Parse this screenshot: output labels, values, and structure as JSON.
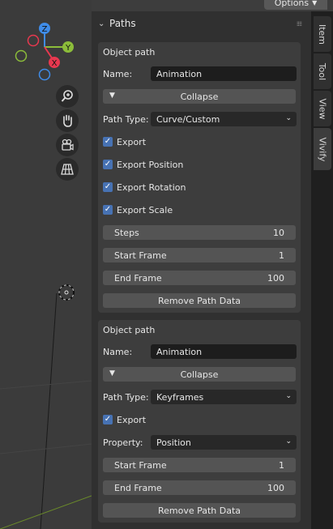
{
  "header": {
    "options_label": "Options"
  },
  "gizmo": {
    "z": "Z",
    "y": "Y",
    "x": "X"
  },
  "panel": {
    "title": "Paths",
    "paths": [
      {
        "heading": "Object path",
        "name_label": "Name:",
        "name_value": "Animation",
        "collapse_label": "Collapse",
        "path_type_label": "Path Type:",
        "path_type_value": "Curve/Custom",
        "checkboxes": [
          "Export",
          "Export Position",
          "Export Rotation",
          "Export Scale"
        ],
        "fields": [
          {
            "label": "Steps",
            "value": "10"
          },
          {
            "label": "Start Frame",
            "value": "1"
          },
          {
            "label": "End Frame",
            "value": "100"
          }
        ],
        "remove_label": "Remove Path Data"
      },
      {
        "heading": "Object path",
        "name_label": "Name:",
        "name_value": "Animation",
        "collapse_label": "Collapse",
        "path_type_label": "Path Type:",
        "path_type_value": "Keyframes",
        "checkboxes": [
          "Export"
        ],
        "property_label": "Property:",
        "property_value": "Position",
        "fields": [
          {
            "label": "Start Frame",
            "value": "1"
          },
          {
            "label": "End Frame",
            "value": "100"
          }
        ],
        "remove_label": "Remove Path Data"
      }
    ]
  },
  "tabs": [
    "Item",
    "Tool",
    "View",
    "Vivify"
  ],
  "colors": {
    "accent": "#4772b3",
    "gizmo_x": "#e8384f",
    "gizmo_y": "#8cbd3a",
    "gizmo_z": "#3f8ce8"
  }
}
